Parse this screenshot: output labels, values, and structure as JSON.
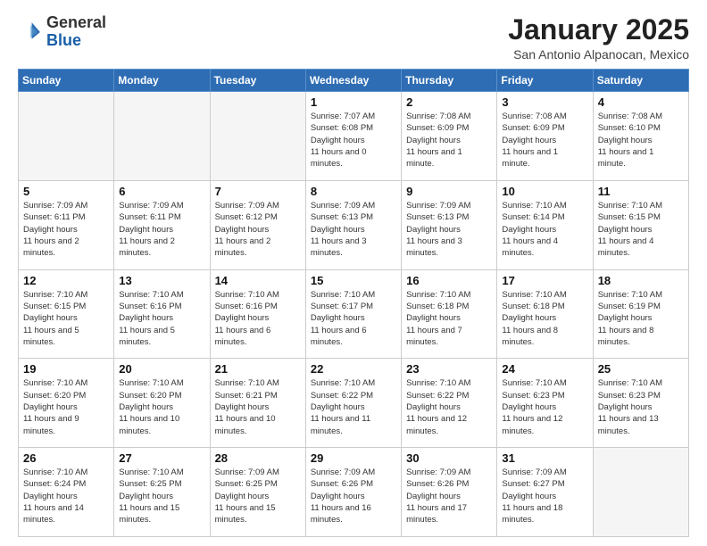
{
  "header": {
    "logo_general": "General",
    "logo_blue": "Blue",
    "month_title": "January 2025",
    "location": "San Antonio Alpanocan, Mexico"
  },
  "days_of_week": [
    "Sunday",
    "Monday",
    "Tuesday",
    "Wednesday",
    "Thursday",
    "Friday",
    "Saturday"
  ],
  "weeks": [
    [
      {
        "day": "",
        "empty": true
      },
      {
        "day": "",
        "empty": true
      },
      {
        "day": "",
        "empty": true
      },
      {
        "day": "1",
        "sunrise": "7:07 AM",
        "sunset": "6:08 PM",
        "daylight": "11 hours and 0 minutes."
      },
      {
        "day": "2",
        "sunrise": "7:08 AM",
        "sunset": "6:09 PM",
        "daylight": "11 hours and 1 minute."
      },
      {
        "day": "3",
        "sunrise": "7:08 AM",
        "sunset": "6:09 PM",
        "daylight": "11 hours and 1 minute."
      },
      {
        "day": "4",
        "sunrise": "7:08 AM",
        "sunset": "6:10 PM",
        "daylight": "11 hours and 1 minute."
      }
    ],
    [
      {
        "day": "5",
        "sunrise": "7:09 AM",
        "sunset": "6:11 PM",
        "daylight": "11 hours and 2 minutes."
      },
      {
        "day": "6",
        "sunrise": "7:09 AM",
        "sunset": "6:11 PM",
        "daylight": "11 hours and 2 minutes."
      },
      {
        "day": "7",
        "sunrise": "7:09 AM",
        "sunset": "6:12 PM",
        "daylight": "11 hours and 2 minutes."
      },
      {
        "day": "8",
        "sunrise": "7:09 AM",
        "sunset": "6:13 PM",
        "daylight": "11 hours and 3 minutes."
      },
      {
        "day": "9",
        "sunrise": "7:09 AM",
        "sunset": "6:13 PM",
        "daylight": "11 hours and 3 minutes."
      },
      {
        "day": "10",
        "sunrise": "7:10 AM",
        "sunset": "6:14 PM",
        "daylight": "11 hours and 4 minutes."
      },
      {
        "day": "11",
        "sunrise": "7:10 AM",
        "sunset": "6:15 PM",
        "daylight": "11 hours and 4 minutes."
      }
    ],
    [
      {
        "day": "12",
        "sunrise": "7:10 AM",
        "sunset": "6:15 PM",
        "daylight": "11 hours and 5 minutes."
      },
      {
        "day": "13",
        "sunrise": "7:10 AM",
        "sunset": "6:16 PM",
        "daylight": "11 hours and 5 minutes."
      },
      {
        "day": "14",
        "sunrise": "7:10 AM",
        "sunset": "6:16 PM",
        "daylight": "11 hours and 6 minutes."
      },
      {
        "day": "15",
        "sunrise": "7:10 AM",
        "sunset": "6:17 PM",
        "daylight": "11 hours and 6 minutes."
      },
      {
        "day": "16",
        "sunrise": "7:10 AM",
        "sunset": "6:18 PM",
        "daylight": "11 hours and 7 minutes."
      },
      {
        "day": "17",
        "sunrise": "7:10 AM",
        "sunset": "6:18 PM",
        "daylight": "11 hours and 8 minutes."
      },
      {
        "day": "18",
        "sunrise": "7:10 AM",
        "sunset": "6:19 PM",
        "daylight": "11 hours and 8 minutes."
      }
    ],
    [
      {
        "day": "19",
        "sunrise": "7:10 AM",
        "sunset": "6:20 PM",
        "daylight": "11 hours and 9 minutes."
      },
      {
        "day": "20",
        "sunrise": "7:10 AM",
        "sunset": "6:20 PM",
        "daylight": "11 hours and 10 minutes."
      },
      {
        "day": "21",
        "sunrise": "7:10 AM",
        "sunset": "6:21 PM",
        "daylight": "11 hours and 10 minutes."
      },
      {
        "day": "22",
        "sunrise": "7:10 AM",
        "sunset": "6:22 PM",
        "daylight": "11 hours and 11 minutes."
      },
      {
        "day": "23",
        "sunrise": "7:10 AM",
        "sunset": "6:22 PM",
        "daylight": "11 hours and 12 minutes."
      },
      {
        "day": "24",
        "sunrise": "7:10 AM",
        "sunset": "6:23 PM",
        "daylight": "11 hours and 12 minutes."
      },
      {
        "day": "25",
        "sunrise": "7:10 AM",
        "sunset": "6:23 PM",
        "daylight": "11 hours and 13 minutes."
      }
    ],
    [
      {
        "day": "26",
        "sunrise": "7:10 AM",
        "sunset": "6:24 PM",
        "daylight": "11 hours and 14 minutes."
      },
      {
        "day": "27",
        "sunrise": "7:10 AM",
        "sunset": "6:25 PM",
        "daylight": "11 hours and 15 minutes."
      },
      {
        "day": "28",
        "sunrise": "7:09 AM",
        "sunset": "6:25 PM",
        "daylight": "11 hours and 15 minutes."
      },
      {
        "day": "29",
        "sunrise": "7:09 AM",
        "sunset": "6:26 PM",
        "daylight": "11 hours and 16 minutes."
      },
      {
        "day": "30",
        "sunrise": "7:09 AM",
        "sunset": "6:26 PM",
        "daylight": "11 hours and 17 minutes."
      },
      {
        "day": "31",
        "sunrise": "7:09 AM",
        "sunset": "6:27 PM",
        "daylight": "11 hours and 18 minutes."
      },
      {
        "day": "",
        "empty": true
      }
    ]
  ]
}
